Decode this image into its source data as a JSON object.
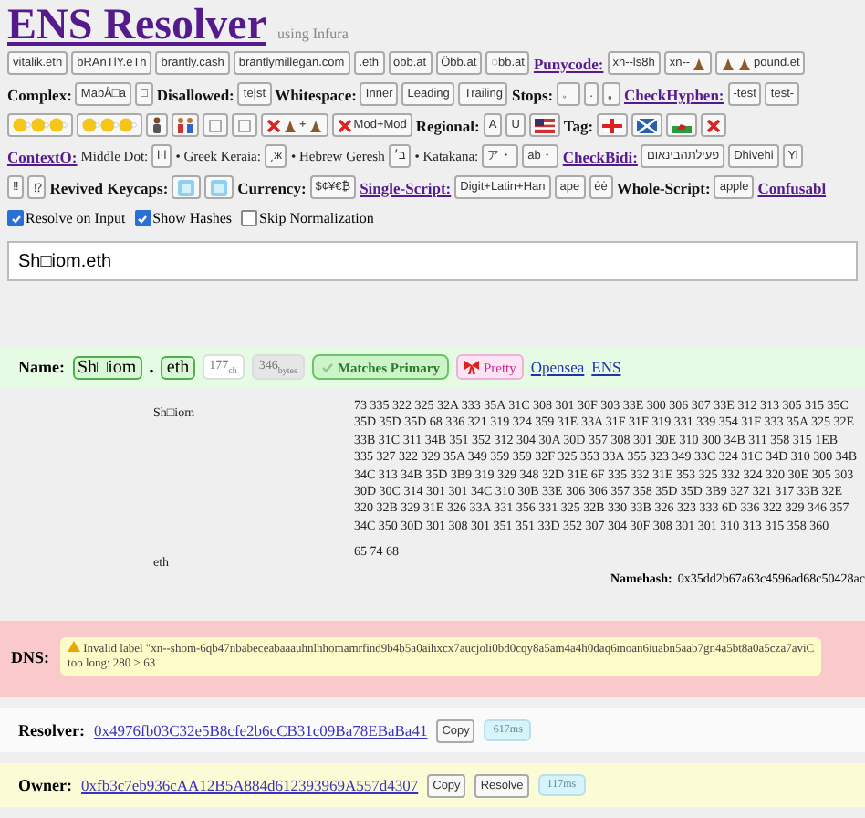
{
  "title": "ENS Resolver",
  "subtitle": "using Infura",
  "toolbar": [
    [
      {
        "kind": "button",
        "label": "vitalik.eth"
      },
      {
        "kind": "button",
        "label": "bRAnTlY.eTh"
      },
      {
        "kind": "button",
        "label": "brantly.cash"
      },
      {
        "kind": "button",
        "label": "brantlymillegan.com"
      },
      {
        "kind": "button",
        "label": ".eth"
      },
      {
        "kind": "button",
        "label": "öbb.at"
      },
      {
        "kind": "button",
        "label": "Öbb.at"
      },
      {
        "kind": "button",
        "label": "◌bb.at"
      },
      {
        "kind": "link",
        "label": "Punycode:"
      },
      {
        "kind": "button",
        "label": "xn--ls8h"
      },
      {
        "kind": "text-pile",
        "label": "xn--"
      },
      {
        "kind": "pile-text",
        "label": "pound.et"
      }
    ],
    [
      {
        "kind": "label",
        "label": "Complex:"
      },
      {
        "kind": "button",
        "label": "MabÅ□a"
      },
      {
        "kind": "button",
        "label": "□"
      },
      {
        "kind": "label",
        "label": "Disallowed:"
      },
      {
        "kind": "button",
        "label": "te|st"
      },
      {
        "kind": "label",
        "label": "Whitespace:"
      },
      {
        "kind": "button",
        "label": "Inner"
      },
      {
        "kind": "button",
        "label": "Leading"
      },
      {
        "kind": "button",
        "label": "Trailing"
      },
      {
        "kind": "label",
        "label": "Stops:"
      },
      {
        "kind": "button",
        "label": "。"
      },
      {
        "kind": "button",
        "label": "."
      },
      {
        "kind": "button",
        "label": "｡"
      },
      {
        "kind": "link",
        "label": "CheckHyphen:"
      },
      {
        "kind": "button",
        "label": "-test"
      },
      {
        "kind": "button",
        "label": "test-"
      }
    ],
    [
      {
        "kind": "faces"
      },
      {
        "kind": "faces"
      },
      {
        "kind": "figure"
      },
      {
        "kind": "family"
      },
      {
        "kind": "glyph"
      },
      {
        "kind": "glyph"
      },
      {
        "kind": "x-pile",
        "label": "+"
      },
      {
        "kind": "x-text",
        "label": "Mod+Mod"
      },
      {
        "kind": "label",
        "label": "Regional:"
      },
      {
        "kind": "button",
        "label": "A"
      },
      {
        "kind": "button",
        "label": "U"
      },
      {
        "kind": "flag-stripes"
      },
      {
        "kind": "label",
        "label": "Tag:"
      },
      {
        "kind": "flag-cross"
      },
      {
        "kind": "flag-saltire"
      },
      {
        "kind": "flag-dragon"
      },
      {
        "kind": "x-text"
      }
    ],
    [
      {
        "kind": "link",
        "label": "ContextO:"
      },
      {
        "kind": "text",
        "label": "Middle Dot:"
      },
      {
        "kind": "button",
        "label": "l·l"
      },
      {
        "kind": "text",
        "label": "• Greek Keraia:"
      },
      {
        "kind": "button",
        "label": "͵ж"
      },
      {
        "kind": "text",
        "label": "• Hebrew Geresh"
      },
      {
        "kind": "button",
        "label": "ב׳"
      },
      {
        "kind": "text",
        "label": "• Katakana:"
      },
      {
        "kind": "button",
        "label": "ア・"
      },
      {
        "kind": "button",
        "label": "ab・"
      },
      {
        "kind": "link",
        "label": "CheckBidi:"
      },
      {
        "kind": "button",
        "label": "פעילתהבינאום"
      },
      {
        "kind": "button",
        "label": "Dhivehi"
      },
      {
        "kind": "button",
        "label": "Yi"
      }
    ],
    [
      {
        "kind": "button",
        "label": "‼"
      },
      {
        "kind": "button",
        "label": "⁉"
      },
      {
        "kind": "label",
        "label": "Revived Keycaps:"
      },
      {
        "kind": "keycap"
      },
      {
        "kind": "keycap"
      },
      {
        "kind": "label",
        "label": "Currency:"
      },
      {
        "kind": "button",
        "label": "$¢¥€₿"
      },
      {
        "kind": "link",
        "label": "Single-Script:"
      },
      {
        "kind": "button",
        "label": "Digit+Latin+Han"
      },
      {
        "kind": "button",
        "label": "ape"
      },
      {
        "kind": "button",
        "label": "ėė"
      },
      {
        "kind": "label",
        "label": "Whole-Script:"
      },
      {
        "kind": "button",
        "label": "apple"
      },
      {
        "kind": "link",
        "label": "Confusabl"
      }
    ]
  ],
  "options": [
    {
      "label": "Resolve on Input",
      "checked": true
    },
    {
      "label": "Show Hashes",
      "checked": true
    },
    {
      "label": "Skip Normalization",
      "checked": false
    }
  ],
  "input": {
    "value": "Sh□iom.eth"
  },
  "name": {
    "label": "Name:",
    "parts": [
      {
        "kind": "chip",
        "text": "Sh□iom"
      },
      {
        "kind": "dot",
        "text": "."
      },
      {
        "kind": "chip",
        "text": "eth"
      }
    ],
    "chars": "177",
    "chars_unit": "ch",
    "bytes": "346",
    "bytes_unit": "bytes",
    "primary": "Matches Primary",
    "pretty": "Pretty",
    "links": [
      "Opensea",
      "ENS"
    ]
  },
  "hashes": {
    "labels": [
      "Sh□iom",
      "eth"
    ],
    "codes": [
      "73 335 322 325 32A 333 35A 31C 308 301 30F 303 33E 300 306 307 33E 312 313 305 315 35C 35D 35D 35D 68 336 321 319 324 359 31E 33A 31F 31F 319 331 339 354 31F 333 35A 325 32E 33B 31C 311 34B 351 352 312 304 30A 30D 357 308 301 30E 310 300 34B 311 358 315 1EB 335 327 322 329 35A 349 359 359 32F 325 353 33A 355 323 349 33C 324 31C 34D 310 300 34B 34C 313 34B 35D 3B9 319 329 348 32D 31E 6F 335 332 31E 353 325 332 324 320 30E 305 303 30D 30C 314 301 301 34C 310 30B 33E 306 306 357 358 35D 35D 3B9 327 321 317 33B 32E 320 32B 329 31E 326 33A 331 356 331 325 32B 330 33B 326 323 333 6D 336 322 329 346 357 34C 350 30D 301 308 301 351 351 33D 352 307 304 30F 308 301 301 310 313 315 358 360",
      "65 74 68"
    ],
    "namehash_label": "Namehash:",
    "namehash": "0x35dd2b67a63c4596ad68c50428ac"
  },
  "dns": {
    "label": "DNS:",
    "error": "Invalid label \"xn--shom-6qb47nbabeceabaaauhnlhhomamrfind9b4b5a0aihxcx7aucjoli0bd0cqy8a5am4a4h0daq6moan6iuabn5aab7gn4a5bt8a0a5cza7aviC",
    "detail": "too long: 280 > 63"
  },
  "records": [
    {
      "label": "Resolver:",
      "address": "0x4976fb03C32e5B8cfe2b6cCB31c09Ba78EBaBa41",
      "buttons": [
        "Copy"
      ],
      "time": "617ms",
      "color": "#fafafa"
    },
    {
      "label": "Owner:",
      "address": "0xfb3c7eb936cAA12B5A884d612393969A557d4307",
      "buttons": [
        "Copy",
        "Resolve"
      ],
      "time": "117ms",
      "color": "#fbfbd6"
    }
  ]
}
